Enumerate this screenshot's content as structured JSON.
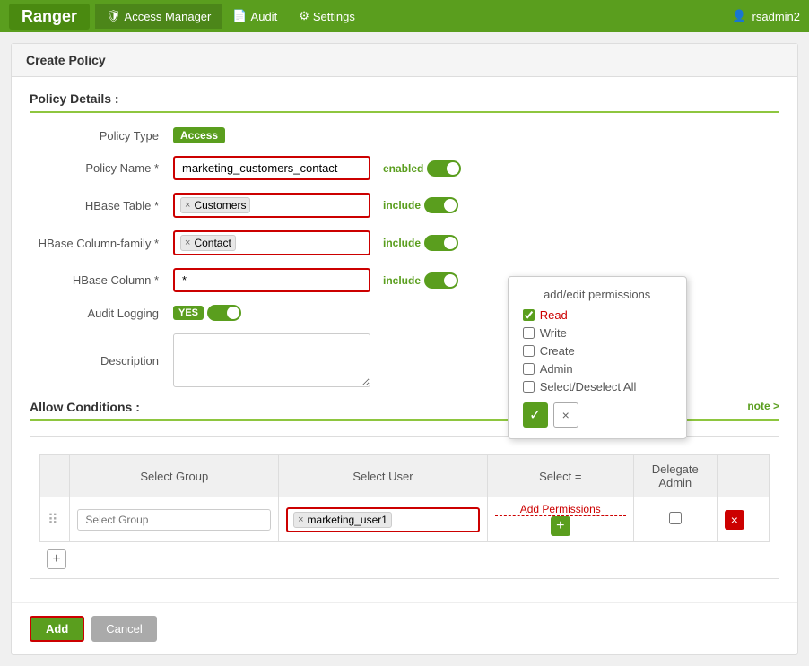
{
  "nav": {
    "brand": "Ranger",
    "items": [
      {
        "label": "Access Manager",
        "icon": "shield",
        "active": true
      },
      {
        "label": "Audit",
        "icon": "file"
      },
      {
        "label": "Settings",
        "icon": "gear"
      }
    ],
    "user": "rsadmin2",
    "user_icon": "user"
  },
  "page": {
    "title": "Create Policy"
  },
  "policy_details": {
    "section_label": "Policy Details :",
    "policy_type_label": "Policy Type",
    "policy_type_value": "Access",
    "policy_name_label": "Policy Name",
    "policy_name_required": true,
    "policy_name_value": "marketing_customers_contact",
    "policy_name_toggle_label": "enabled",
    "hbase_table_label": "HBase Table",
    "hbase_table_required": true,
    "hbase_table_tag": "Customers",
    "hbase_table_toggle_label": "include",
    "hbase_column_family_label": "HBase Column-family",
    "hbase_column_family_required": true,
    "hbase_column_family_tag": "Contact",
    "hbase_column_family_toggle_label": "include",
    "hbase_column_label": "HBase Column",
    "hbase_column_required": true,
    "hbase_column_value": "*",
    "hbase_column_toggle_label": "include",
    "audit_logging_label": "Audit Logging",
    "audit_logging_value": "YES",
    "description_label": "Description",
    "description_placeholder": ""
  },
  "allow_conditions": {
    "section_label": "Allow Conditions :",
    "note_link": "note >",
    "table": {
      "headers": {
        "select_group": "Select Group",
        "select_user": "Select User",
        "permissions": "Select =",
        "delegate_admin": "Delegate Admin"
      },
      "rows": [
        {
          "select_group_placeholder": "Select Group",
          "select_user_tag": "marketing_user1",
          "permissions_link": "Add Permissions",
          "permissions_icon": "+",
          "delegate_checked": false,
          "delete_icon": "×"
        }
      ],
      "add_row_icon": "+"
    }
  },
  "permissions_popup": {
    "title": "add/edit permissions",
    "options": [
      {
        "label": "Read",
        "checked": true
      },
      {
        "label": "Write",
        "checked": false
      },
      {
        "label": "Create",
        "checked": false
      },
      {
        "label": "Admin",
        "checked": false
      },
      {
        "label": "Select/Deselect All",
        "checked": false
      }
    ],
    "ok_icon": "✓",
    "cancel_icon": "×"
  },
  "buttons": {
    "add_label": "Add",
    "cancel_label": "Cancel"
  }
}
